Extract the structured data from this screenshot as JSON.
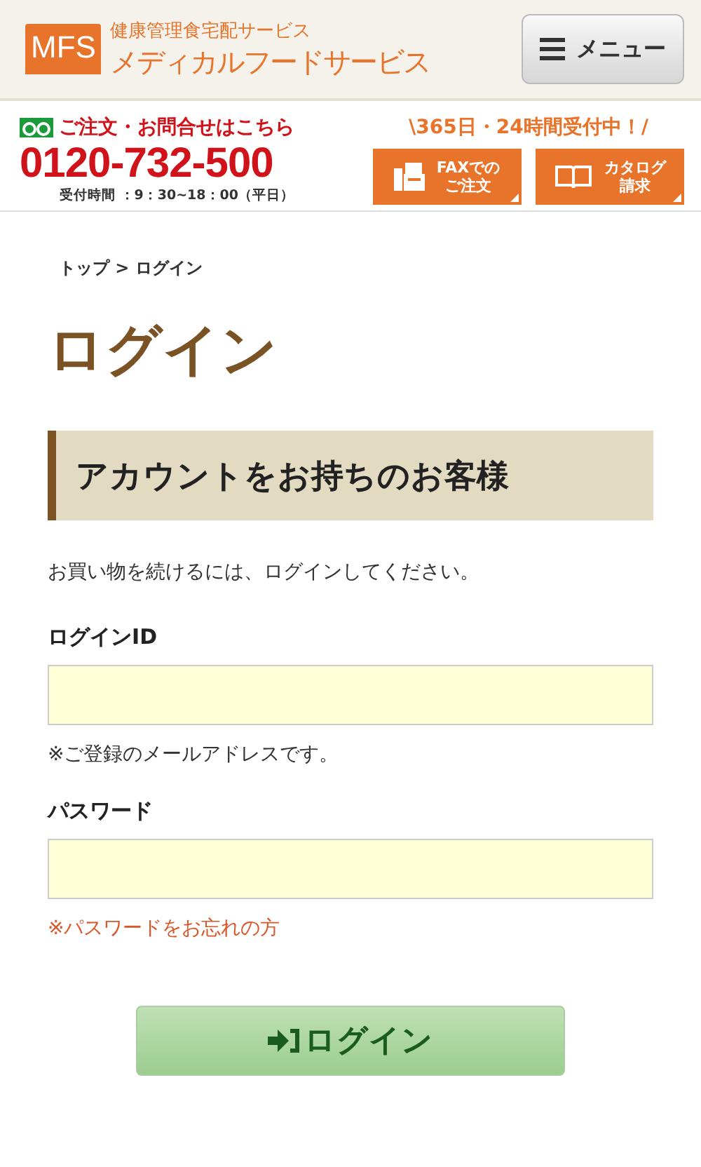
{
  "header": {
    "logo": "MFS",
    "tagline": "健康管理食宅配サービス",
    "brand": "メディカルフードサービス",
    "menu_button": "メニュー"
  },
  "contact": {
    "heading": "ご注文・お問合せはこちら",
    "phone": "0120-732-500",
    "hours": "受付時間 ：9：30~18：00（平日）",
    "banner": "\\365日・24時間受付中！/",
    "buttons": [
      {
        "kind": "fax",
        "lines": [
          "FAXでの",
          "ご注文"
        ]
      },
      {
        "kind": "catalog",
        "lines": [
          "カタログ",
          "請求"
        ]
      }
    ]
  },
  "breadcrumb": "トップ > ログイン",
  "title": "ログイン",
  "section_heading": "アカウントをお持ちのお客様",
  "intro": "お買い物を続けるには、ログインしてください。",
  "fields": [
    {
      "label": "ログインID",
      "note": "※ご登録のメールアドレスです。",
      "kind": "hint"
    },
    {
      "label": "パスワード",
      "note": "※パスワードをお忘れの方",
      "kind": "link"
    }
  ],
  "submit": "ログイン"
}
